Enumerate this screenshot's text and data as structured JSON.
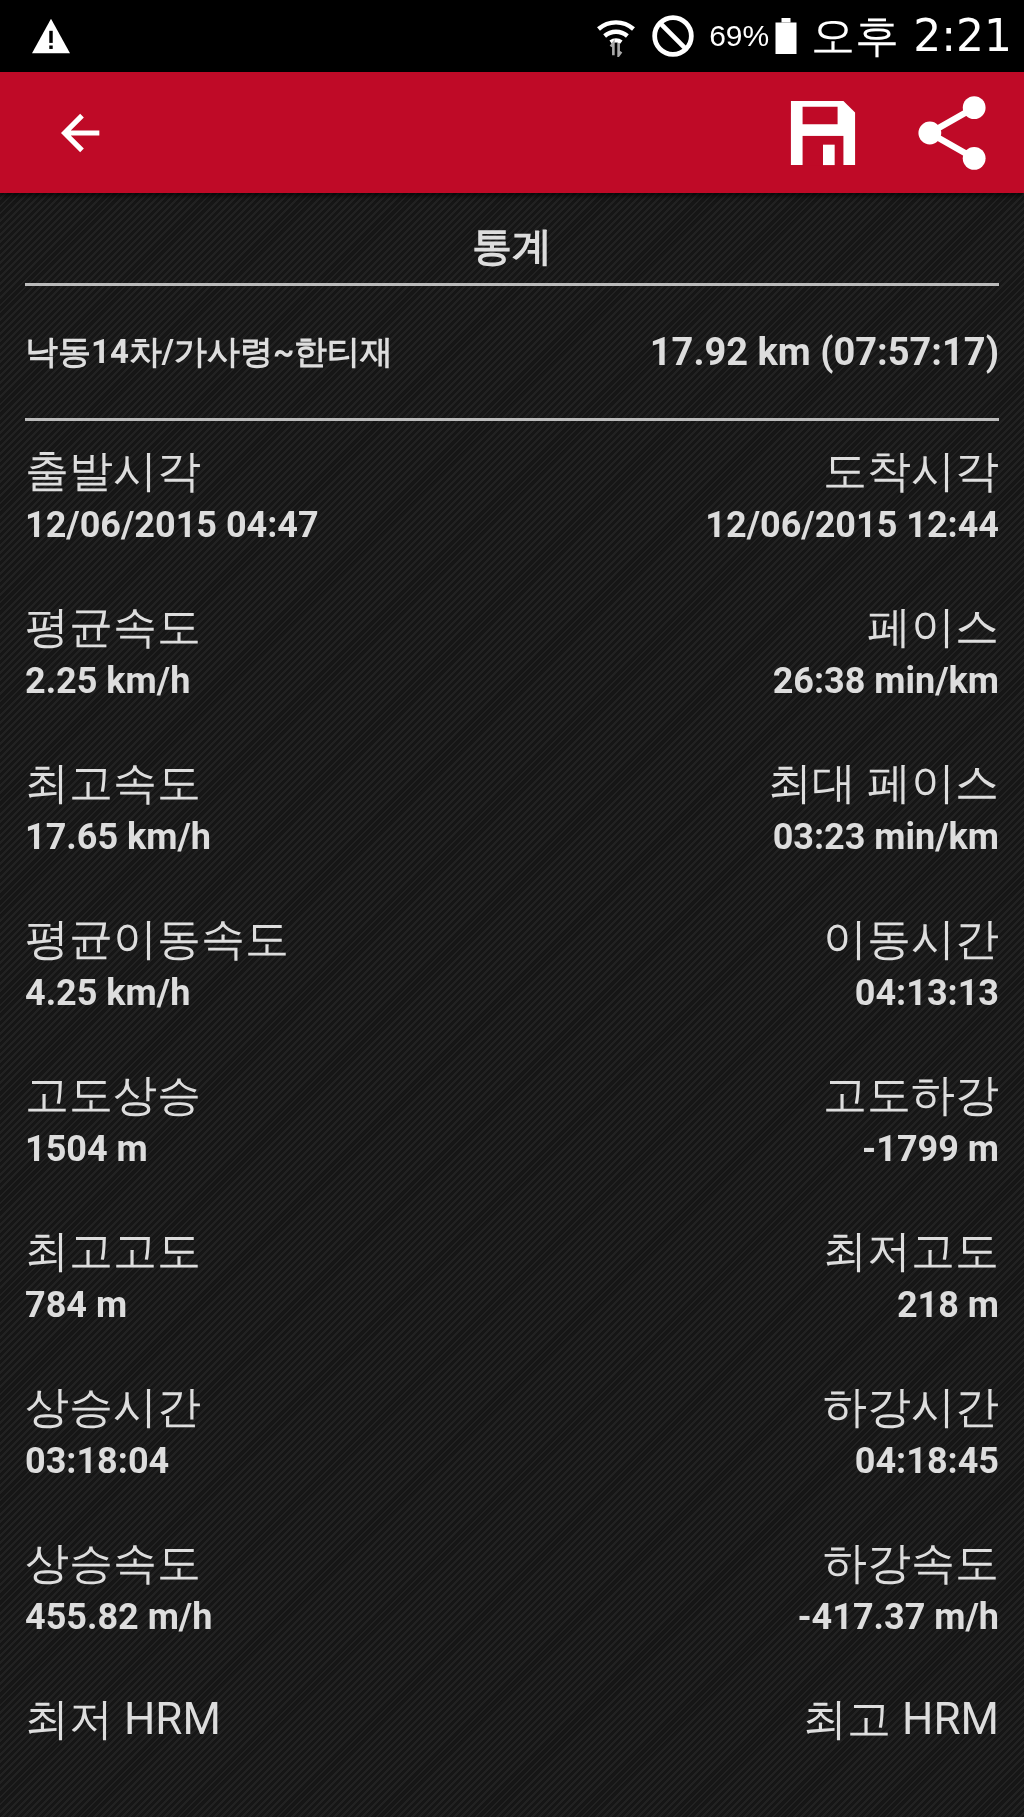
{
  "status_bar": {
    "battery": "69%",
    "time": "오후 2:21"
  },
  "title": "통계",
  "track": {
    "name": "낙동14차/가사령~한티재",
    "summary": "17.92 km (07:57:17)"
  },
  "stats": [
    {
      "left": {
        "label": "출발시각",
        "value": "12/06/2015 04:47"
      },
      "right": {
        "label": "도착시각",
        "value": "12/06/2015 12:44"
      }
    },
    {
      "left": {
        "label": "평균속도",
        "value": "2.25 km/h"
      },
      "right": {
        "label": "페이스",
        "value": "26:38 min/km"
      }
    },
    {
      "left": {
        "label": "최고속도",
        "value": "17.65 km/h"
      },
      "right": {
        "label": "최대 페이스",
        "value": "03:23 min/km"
      }
    },
    {
      "left": {
        "label": "평균이동속도",
        "value": "4.25 km/h"
      },
      "right": {
        "label": "이동시간",
        "value": "04:13:13"
      }
    },
    {
      "left": {
        "label": "고도상승",
        "value": "1504 m"
      },
      "right": {
        "label": "고도하강",
        "value": "-1799 m"
      }
    },
    {
      "left": {
        "label": "최고고도",
        "value": "784 m"
      },
      "right": {
        "label": "최저고도",
        "value": "218 m"
      }
    },
    {
      "left": {
        "label": "상승시간",
        "value": "03:18:04"
      },
      "right": {
        "label": "하강시간",
        "value": "04:18:45"
      }
    },
    {
      "left": {
        "label": "상승속도",
        "value": "455.82 m/h"
      },
      "right": {
        "label": "하강속도",
        "value": "-417.37 m/h"
      }
    },
    {
      "left": {
        "label": "최저 HRM"
      },
      "right": {
        "label": "최고 HRM"
      }
    }
  ]
}
